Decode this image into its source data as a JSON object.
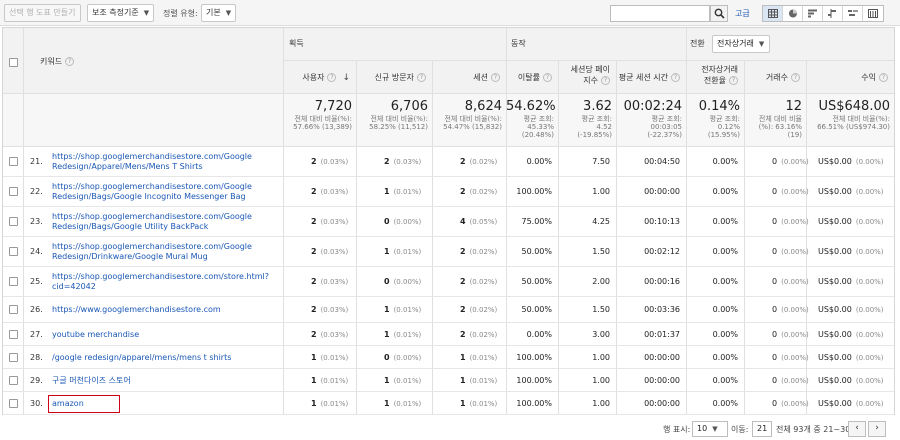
{
  "toolbar": {
    "select_rows_label": "선택 행 도표 만들기",
    "secondary_dimension_label": "보조 측정기준",
    "sort_type_label": "정렬 유형:",
    "sort_type_value": "기본",
    "advanced_label": "고급",
    "view_icons": [
      "table-view-icon",
      "pie-view-icon",
      "performance-view-icon",
      "comparison-view-icon",
      "term-cloud-icon",
      "pivot-view-icon"
    ]
  },
  "table": {
    "keyword_header": "키워드",
    "groups": {
      "acquisition": "획득",
      "behavior": "동작",
      "conversion": "전환",
      "conversion_select": "전자상거래"
    },
    "columns": [
      "사용자",
      "신규 방문자",
      "세션",
      "이탈률",
      "세션당 페이지수",
      "평균 세션 시간",
      "전자상거래 전환율",
      "거래수",
      "수익"
    ],
    "columns_split": {
      "pages_per_session": [
        "세션당 페이",
        "지수"
      ],
      "ecommerce_rate": [
        "전자상거래",
        "전환율"
      ]
    },
    "totals": [
      {
        "main": "7,720",
        "sub": [
          "전체 대비 비율(%):",
          "57.66% (13,389)"
        ]
      },
      {
        "main": "6,706",
        "sub": [
          "전체 대비 비율(%):",
          "58.25% (11,512)"
        ]
      },
      {
        "main": "8,624",
        "sub": [
          "전체 대비 비율(%):",
          "54.47% (15,832)"
        ]
      },
      {
        "main": "54.62%",
        "sub": [
          "평균 조회:",
          "45.33%",
          "(20.48%)"
        ]
      },
      {
        "main": "3.62",
        "sub": [
          "평균 조회:",
          "4.52",
          "(-19.85%)"
        ]
      },
      {
        "main": "00:02:24",
        "sub": [
          "평균 조회:",
          "00:03:05",
          "(-22.37%)"
        ]
      },
      {
        "main": "0.14%",
        "sub": [
          "평균 조회:",
          "0.12%",
          "(15.95%)"
        ]
      },
      {
        "main": "12",
        "sub": [
          "전체 대비 비율",
          "(%): 63.16%",
          "(19)"
        ]
      },
      {
        "main": "US$648.00",
        "sub": [
          "전체 대비 비율(%):",
          "66.51% (US$974.30)"
        ]
      }
    ],
    "rows": [
      {
        "num": "21.",
        "keyword": [
          "https://shop.googlemerchandisestore.com/Google",
          "Redesign/Apparel/Mens/Mens T Shirts"
        ],
        "users": "2",
        "users_pct": "(0.03%)",
        "new": "2",
        "new_pct": "(0.03%)",
        "sessions": "2",
        "sessions_pct": "(0.02%)",
        "bounce": "0.00%",
        "pps": "7.50",
        "dur": "00:04:50",
        "conv": "0.00%",
        "tx": "0",
        "tx_pct": "(0.00%)",
        "rev": "US$0.00",
        "rev_pct": "(0.00%)"
      },
      {
        "num": "22.",
        "keyword": [
          "https://shop.googlemerchandisestore.com/Google",
          "Redesign/Bags/Google Incognito Messenger Bag"
        ],
        "users": "2",
        "users_pct": "(0.03%)",
        "new": "1",
        "new_pct": "(0.01%)",
        "sessions": "2",
        "sessions_pct": "(0.02%)",
        "bounce": "100.00%",
        "pps": "1.00",
        "dur": "00:00:00",
        "conv": "0.00%",
        "tx": "0",
        "tx_pct": "(0.00%)",
        "rev": "US$0.00",
        "rev_pct": "(0.00%)"
      },
      {
        "num": "23.",
        "keyword": [
          "https://shop.googlemerchandisestore.com/Google",
          "Redesign/Bags/Google Utility BackPack"
        ],
        "users": "2",
        "users_pct": "(0.03%)",
        "new": "0",
        "new_pct": "(0.00%)",
        "sessions": "4",
        "sessions_pct": "(0.05%)",
        "bounce": "75.00%",
        "pps": "4.25",
        "dur": "00:10:13",
        "conv": "0.00%",
        "tx": "0",
        "tx_pct": "(0.00%)",
        "rev": "US$0.00",
        "rev_pct": "(0.00%)"
      },
      {
        "num": "24.",
        "keyword": [
          "https://shop.googlemerchandisestore.com/Google",
          "Redesign/Drinkware/Google Mural Mug"
        ],
        "users": "2",
        "users_pct": "(0.03%)",
        "new": "1",
        "new_pct": "(0.01%)",
        "sessions": "2",
        "sessions_pct": "(0.02%)",
        "bounce": "50.00%",
        "pps": "1.50",
        "dur": "00:02:12",
        "conv": "0.00%",
        "tx": "0",
        "tx_pct": "(0.00%)",
        "rev": "US$0.00",
        "rev_pct": "(0.00%)"
      },
      {
        "num": "25.",
        "keyword": [
          "https://shop.googlemerchandisestore.com/store.html?",
          "cid=42042"
        ],
        "users": "2",
        "users_pct": "(0.03%)",
        "new": "0",
        "new_pct": "(0.00%)",
        "sessions": "2",
        "sessions_pct": "(0.02%)",
        "bounce": "50.00%",
        "pps": "2.00",
        "dur": "00:00:16",
        "conv": "0.00%",
        "tx": "0",
        "tx_pct": "(0.00%)",
        "rev": "US$0.00",
        "rev_pct": "(0.00%)"
      },
      {
        "num": "26.",
        "keyword": [
          "https://www.googlemerchandisestore.com"
        ],
        "users": "2",
        "users_pct": "(0.03%)",
        "new": "1",
        "new_pct": "(0.01%)",
        "sessions": "2",
        "sessions_pct": "(0.02%)",
        "bounce": "50.00%",
        "pps": "1.50",
        "dur": "00:03:36",
        "conv": "0.00%",
        "tx": "0",
        "tx_pct": "(0.00%)",
        "rev": "US$0.00",
        "rev_pct": "(0.00%)"
      },
      {
        "num": "27.",
        "keyword": [
          "youtube merchandise"
        ],
        "users": "2",
        "users_pct": "(0.03%)",
        "new": "1",
        "new_pct": "(0.01%)",
        "sessions": "2",
        "sessions_pct": "(0.02%)",
        "bounce": "0.00%",
        "pps": "3.00",
        "dur": "00:01:37",
        "conv": "0.00%",
        "tx": "0",
        "tx_pct": "(0.00%)",
        "rev": "US$0.00",
        "rev_pct": "(0.00%)"
      },
      {
        "num": "28.",
        "keyword": [
          "/google redesign/apparel/mens/mens t shirts"
        ],
        "users": "1",
        "users_pct": "(0.01%)",
        "new": "0",
        "new_pct": "(0.00%)",
        "sessions": "1",
        "sessions_pct": "(0.01%)",
        "bounce": "100.00%",
        "pps": "1.00",
        "dur": "00:00:00",
        "conv": "0.00%",
        "tx": "0",
        "tx_pct": "(0.00%)",
        "rev": "US$0.00",
        "rev_pct": "(0.00%)"
      },
      {
        "num": "29.",
        "keyword": [
          "구글 머천다이즈 스토어"
        ],
        "users": "1",
        "users_pct": "(0.01%)",
        "new": "1",
        "new_pct": "(0.01%)",
        "sessions": "1",
        "sessions_pct": "(0.01%)",
        "bounce": "100.00%",
        "pps": "1.00",
        "dur": "00:00:00",
        "conv": "0.00%",
        "tx": "0",
        "tx_pct": "(0.00%)",
        "rev": "US$0.00",
        "rev_pct": "(0.00%)"
      },
      {
        "num": "30.",
        "keyword": [
          "amazon"
        ],
        "users": "1",
        "users_pct": "(0.01%)",
        "new": "1",
        "new_pct": "(0.01%)",
        "sessions": "1",
        "sessions_pct": "(0.01%)",
        "bounce": "100.00%",
        "pps": "1.00",
        "dur": "00:00:00",
        "conv": "0.00%",
        "tx": "0",
        "tx_pct": "(0.00%)",
        "rev": "US$0.00",
        "rev_pct": "(0.00%)"
      }
    ]
  },
  "footer": {
    "rows_label": "행 표시:",
    "rows_value": "10",
    "goto_label": "이동:",
    "goto_value": "21",
    "range_text": "전체 93개 중 21~30",
    "prev_icon": "‹",
    "next_icon": "›"
  },
  "colors": {
    "link": "#1a57b5",
    "highlight": "#d0021b"
  }
}
